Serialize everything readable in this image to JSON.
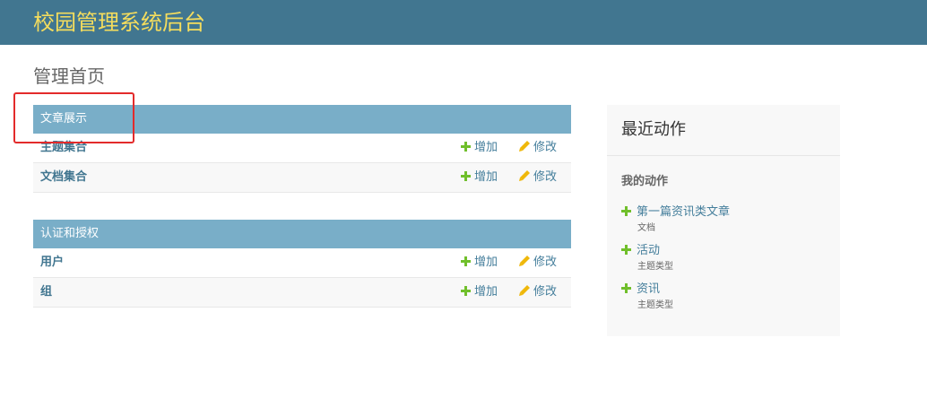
{
  "header": {
    "site_title": "校园管理系统后台"
  },
  "page": {
    "title": "管理首页"
  },
  "modules": [
    {
      "caption": "文章展示",
      "rows": [
        {
          "name": "主题集合",
          "add_label": "增加",
          "change_label": "修改"
        },
        {
          "name": "文档集合",
          "add_label": "增加",
          "change_label": "修改"
        }
      ]
    },
    {
      "caption": "认证和授权",
      "rows": [
        {
          "name": "用户",
          "add_label": "增加",
          "change_label": "修改"
        },
        {
          "name": "组",
          "add_label": "增加",
          "change_label": "修改"
        }
      ]
    }
  ],
  "recent_actions": {
    "title": "最近动作",
    "my_actions_label": "我的动作",
    "items": [
      {
        "label": "第一篇资讯类文章",
        "type": "文档",
        "icon": "plus-icon"
      },
      {
        "label": "活动",
        "type": "主题类型",
        "icon": "plus-icon"
      },
      {
        "label": "资讯",
        "type": "主题类型",
        "icon": "plus-icon"
      }
    ]
  },
  "colors": {
    "header_bg": "#417690",
    "site_title": "#f5dd5d",
    "module_caption_bg": "#79aec8",
    "link": "#447e9b",
    "add_icon": "#70bf2b",
    "change_icon": "#efb80b",
    "highlight_box": "#e32b2b"
  }
}
